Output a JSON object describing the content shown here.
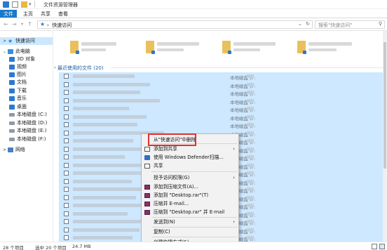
{
  "window": {
    "title": "文件资源管理器"
  },
  "ribbon": {
    "tabs": [
      "文件",
      "主页",
      "共享",
      "查看"
    ]
  },
  "address": {
    "crumb": "快速访问",
    "search_placeholder": "搜索\"快速访问\""
  },
  "sidebar": {
    "items": [
      {
        "label": "快速访问",
        "icon": "star-icon",
        "selected": true
      },
      {
        "label": "此电脑",
        "icon": "computer-icon"
      },
      {
        "label": "3D 对象",
        "icon": "3d-objects-icon"
      },
      {
        "label": "视频",
        "icon": "video-icon"
      },
      {
        "label": "图片",
        "icon": "picture-icon"
      },
      {
        "label": "文档",
        "icon": "document-icon"
      },
      {
        "label": "下载",
        "icon": "download-icon"
      },
      {
        "label": "音乐",
        "icon": "music-icon"
      },
      {
        "label": "桌面",
        "icon": "desktop-icon"
      },
      {
        "label": "本地磁盘 (C:)",
        "icon": "drive-icon"
      },
      {
        "label": "本地磁盘 (D:)",
        "icon": "drive-icon"
      },
      {
        "label": "本地磁盘 (E:)",
        "icon": "drive-icon"
      },
      {
        "label": "本地磁盘 (F:)",
        "icon": "drive-icon"
      },
      {
        "label": "网络",
        "icon": "network-icon"
      }
    ]
  },
  "main": {
    "group_header": "最近使用的文件 (20)",
    "location_prefix": "本地磁盘 ("
  },
  "context_menu": {
    "items": [
      {
        "label": "从\"快速访问\"中删除",
        "icon": "",
        "submenu": false
      },
      {
        "label": "添加到共享",
        "icon": "share-icon",
        "submenu": true
      },
      {
        "label": "使用 Windows Defender扫描...",
        "icon": "shield-icon",
        "submenu": false
      },
      {
        "label": "共享",
        "icon": "share-icon",
        "submenu": false
      },
      {
        "label": "授予访问权限(G)",
        "icon": "",
        "submenu": true
      },
      {
        "label": "添加到压缩文件(A)...",
        "icon": "rar-icon",
        "submenu": false
      },
      {
        "label": "添加到 \"Desktop.rar\"(T)",
        "icon": "rar-icon",
        "submenu": false
      },
      {
        "label": "压缩并 E-mail...",
        "icon": "rar-icon",
        "submenu": false
      },
      {
        "label": "压缩到 \"Desktop.rar\" 并 E-mail",
        "icon": "rar-icon",
        "submenu": false
      },
      {
        "label": "发送到(N)",
        "icon": "",
        "submenu": true
      },
      {
        "label": "复制(C)",
        "icon": "",
        "submenu": false
      },
      {
        "label": "创建快捷方式(S)",
        "icon": "",
        "submenu": false
      }
    ]
  },
  "status": {
    "item_count": "28 个项目",
    "selected": "选中 20 个项目",
    "size": "24.7 MB"
  }
}
